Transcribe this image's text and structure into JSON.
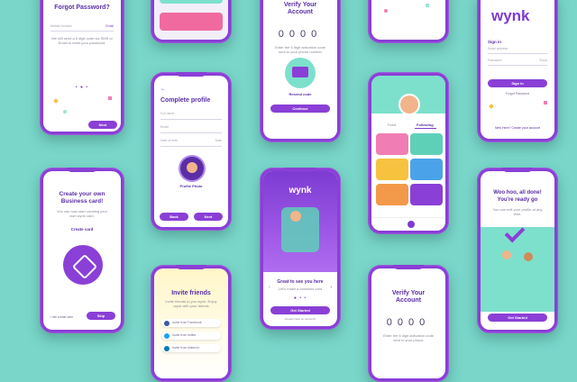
{
  "forgot": {
    "title": "Forgot Password?",
    "field_label": "Mobile Number",
    "field_right": "Email",
    "hint": "We will send a 6 digit code via SMS or Email to reset your password.",
    "next": "Next"
  },
  "verify_top": {
    "title": "Verify Your Account",
    "code": "0000",
    "hint": "Enter the 6 digit activation code sent to your phone number",
    "resend": "Resend code",
    "continue": "Continue"
  },
  "login": {
    "logo": "wynk",
    "sign_in_heading": "Sign in",
    "email_label": "Email address",
    "password_label": "Password",
    "show": "Show",
    "sign_in_btn": "Sign in",
    "forgot": "Forgot Password",
    "create": "New Here? Create your account"
  },
  "profile": {
    "title": "Complete profile",
    "field1": "Full name",
    "field2": "Email",
    "field3": "Date of birth",
    "field3_right": "Date",
    "photo_label": "Profile Photo",
    "back": "Back",
    "next": "Next"
  },
  "social": {
    "tab1": "Feed",
    "tab2": "Following"
  },
  "card": {
    "title": "Create your own Business card!",
    "hint": "You can now start creating your own wynk card.",
    "create": "Create card",
    "later": "I will create later",
    "skip": "Skip"
  },
  "welcome": {
    "logo": "wynk",
    "title": "Great to see you here",
    "subtitle": "Let's make a business card",
    "cta": "Get Started",
    "footer": "Already have an account?"
  },
  "done": {
    "title": "Woo hoo, all done! You're ready go",
    "hint": "You can edit your profile at any time.",
    "cta": "Get Started"
  },
  "invite": {
    "title": "Invite friends",
    "hint": "Invite friends to you wynk. Enjoy wynk with your friends",
    "rows": [
      "Invite from Facebook",
      "Invite from twitter",
      "Invite from linked in"
    ]
  },
  "verify_bottom": {
    "title": "Verify Your Account",
    "code": "0000",
    "hint": "Enter the 6 digit activation code sent to your phone"
  },
  "colors": {
    "background": "#79d6c9",
    "phone": "#8a3fd6",
    "accent": "#7d3bd3"
  }
}
